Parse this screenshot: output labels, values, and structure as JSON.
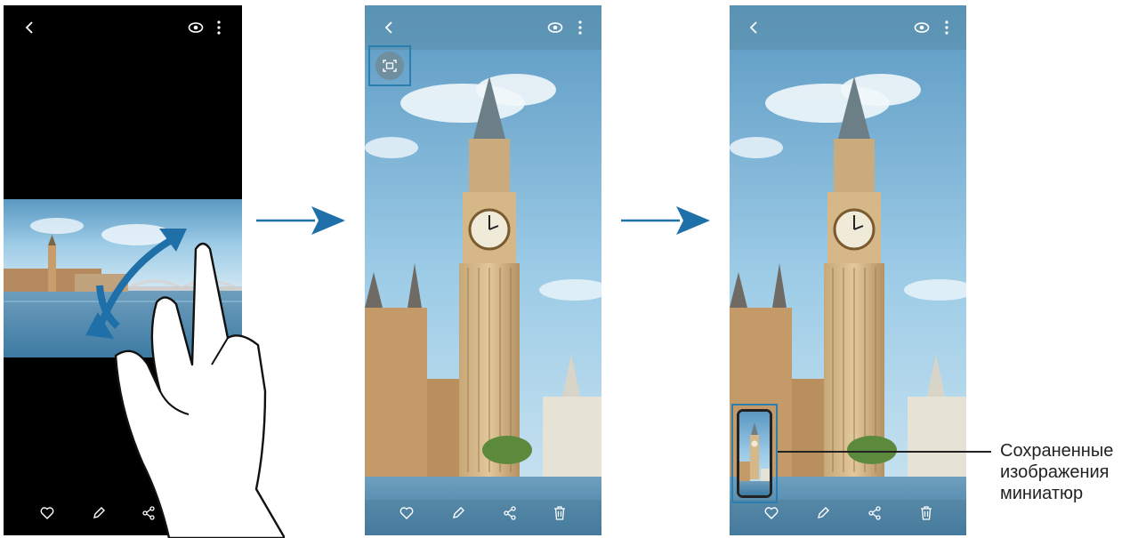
{
  "screens": [
    {
      "name": "gesture-screen",
      "bottom_bar": [
        "heart-icon",
        "pencil-icon",
        "share-icon"
      ]
    },
    {
      "name": "fullscreen-screen",
      "capture_button": "screen-capture-icon",
      "bottom_bar": [
        "heart-icon",
        "pencil-icon",
        "share-icon",
        "trash-icon"
      ]
    },
    {
      "name": "thumbnail-screen",
      "bottom_bar": [
        "heart-icon",
        "pencil-icon",
        "share-icon",
        "trash-icon"
      ]
    }
  ],
  "top_bar_icons": [
    "back-icon",
    "eye-icon",
    "more-options-icon"
  ],
  "callout": {
    "line1": "Сохраненные",
    "line2": "изображения",
    "line3": "миниатюр"
  },
  "colors": {
    "arrow": "#1f6fa8",
    "highlight": "#2a7fb0",
    "gesture_arrow": "#1f6fa8",
    "sky": "#9ccbe6",
    "water": "#4a8db4"
  }
}
